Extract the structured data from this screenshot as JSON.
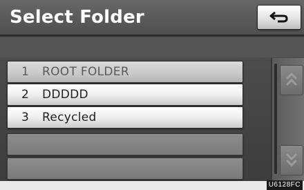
{
  "header": {
    "title": "Select Folder",
    "back_icon": "return-arrow-icon"
  },
  "folders": [
    {
      "number": "1",
      "name": "ROOT FOLDER",
      "state": "dim"
    },
    {
      "number": "2",
      "name": "DDDDD",
      "state": "normal"
    },
    {
      "number": "3",
      "name": "Recycled",
      "state": "normal"
    },
    {
      "number": "",
      "name": "",
      "state": "empty"
    },
    {
      "number": "",
      "name": "",
      "state": "empty"
    }
  ],
  "scroll": {
    "up_icon": "double-up-arrow-icon",
    "down_icon": "double-down-arrow-icon"
  },
  "footer": {
    "code": "U6128FC"
  },
  "colors": {
    "header_bg": "#4f4f4f",
    "list_item_bg": "#eeeeee",
    "screen_bg": "#4a4a4a"
  }
}
